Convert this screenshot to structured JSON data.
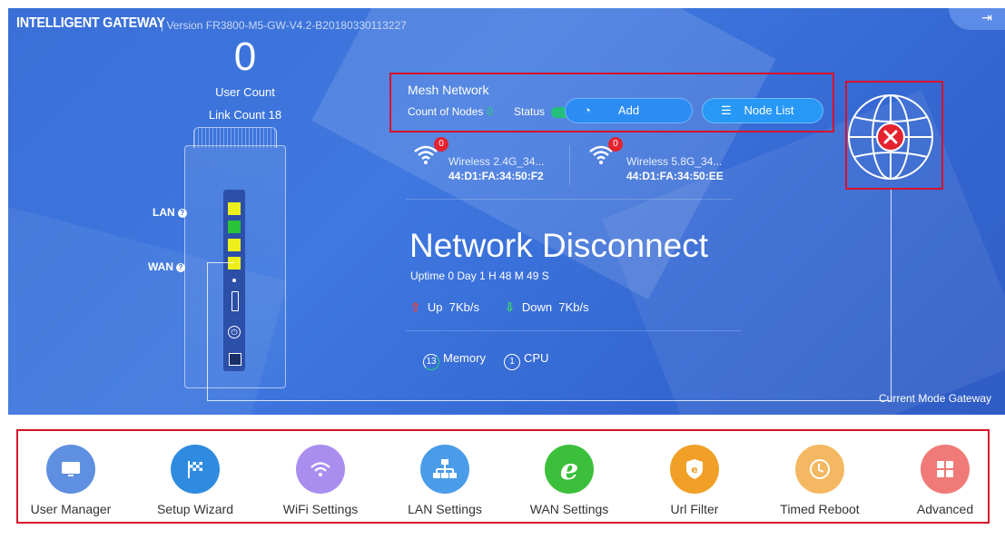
{
  "header": {
    "brand": "INTELLIGENT GATEWAY",
    "version": "| Version FR3800-M5-GW-V4.2-B20180330113227",
    "logout_icon": "logout-icon"
  },
  "device": {
    "user_count": "0",
    "user_count_label": "User Count",
    "link_count": "Link Count 18",
    "lan_label": "LAN",
    "wan_label": "WAN",
    "help_glyph": "?"
  },
  "mesh": {
    "title": "Mesh Network",
    "count_label": "Count of Nodes",
    "count_value": "0",
    "status_label": "Status",
    "add_label": "Add",
    "node_list_label": "Node List"
  },
  "wireless": [
    {
      "badge": "0",
      "name": "Wireless 2.4G_34...",
      "mac": "44:D1:FA:34:50:F2"
    },
    {
      "badge": "0",
      "name": "Wireless 5.8G_34...",
      "mac": "44:D1:FA:34:50:EE"
    }
  ],
  "status": {
    "network": "Network Disconnect",
    "uptime": "Uptime 0 Day 1 H 48 M 49 S",
    "up_label": "Up",
    "up_value": "7Kb/s",
    "down_label": "Down",
    "down_value": "7Kb/s",
    "memory_value": "13",
    "memory_label": "Memory",
    "cpu_value": "1",
    "cpu_label": "CPU"
  },
  "mode": "Current Mode Gateway",
  "colors": {
    "accent": "#3a6fd6",
    "highlight_border": "#d7122a",
    "error": "#e4232f",
    "ok": "#29d46b"
  },
  "dock": [
    {
      "label": "User Manager",
      "icon": "monitor-icon",
      "color": "#5e8fe0"
    },
    {
      "label": "Setup Wizard",
      "icon": "flag-icon",
      "color": "#2f8be0"
    },
    {
      "label": "WiFi Settings",
      "icon": "wifi-icon",
      "color": "#a98ef0"
    },
    {
      "label": "LAN Settings",
      "icon": "network-icon",
      "color": "#4a9ce8"
    },
    {
      "label": "WAN Settings",
      "icon": "ie-icon",
      "color": "#3cbf3a"
    },
    {
      "label": "Url Filter",
      "icon": "shield-icon",
      "color": "#f0a027"
    },
    {
      "label": "Timed Reboot",
      "icon": "clock-icon",
      "color": "#f4b862"
    },
    {
      "label": "Advanced",
      "icon": "grid-icon",
      "color": "#f07a78"
    }
  ]
}
